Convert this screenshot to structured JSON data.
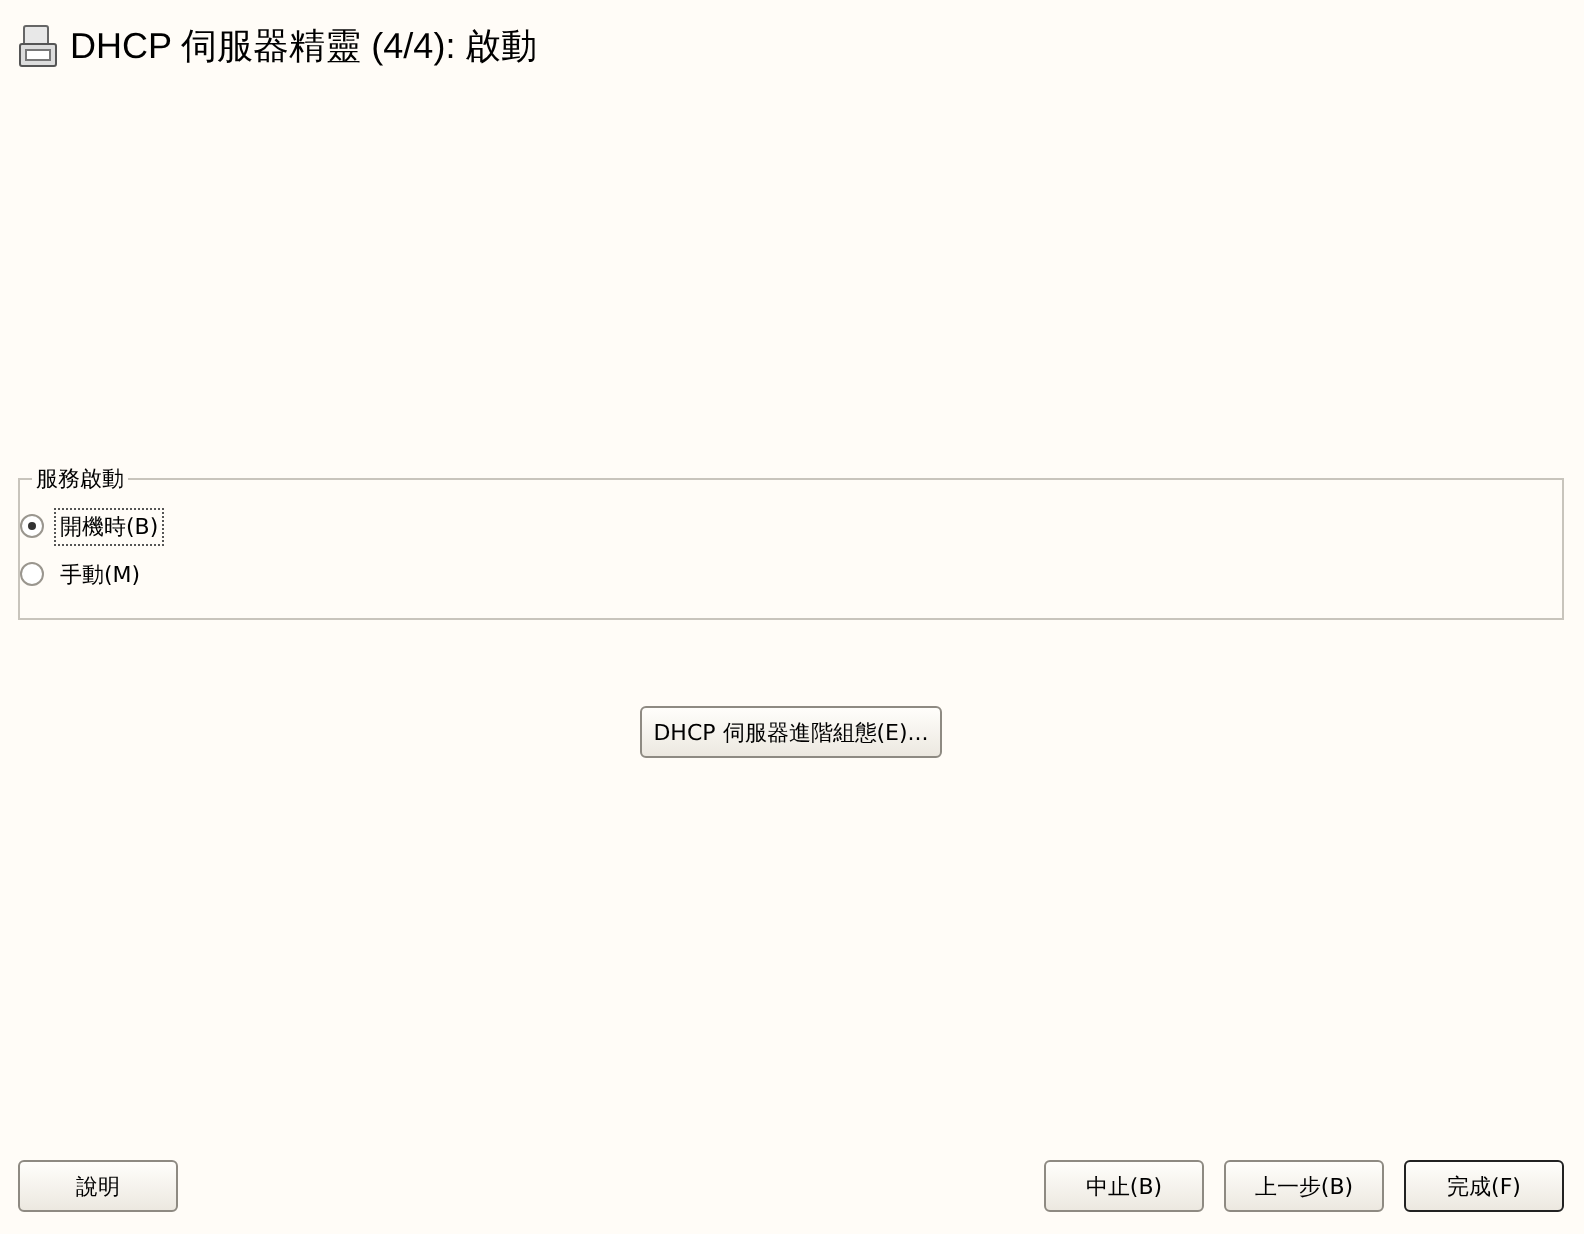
{
  "window": {
    "title": "DHCP 伺服器精靈 (4/4): 啟動"
  },
  "service_start": {
    "legend": "服務啟動",
    "options": [
      {
        "label": "開機時(B)",
        "selected": true
      },
      {
        "label": "手動(M)",
        "selected": false
      }
    ]
  },
  "advanced_button": "DHCP 伺服器進階組態(E)...",
  "buttons": {
    "help": "說明",
    "actions": [
      {
        "label": "中止(B)",
        "default": false
      },
      {
        "label": "上一步(B)",
        "default": false
      },
      {
        "label": "完成(F)",
        "default": true
      }
    ]
  }
}
